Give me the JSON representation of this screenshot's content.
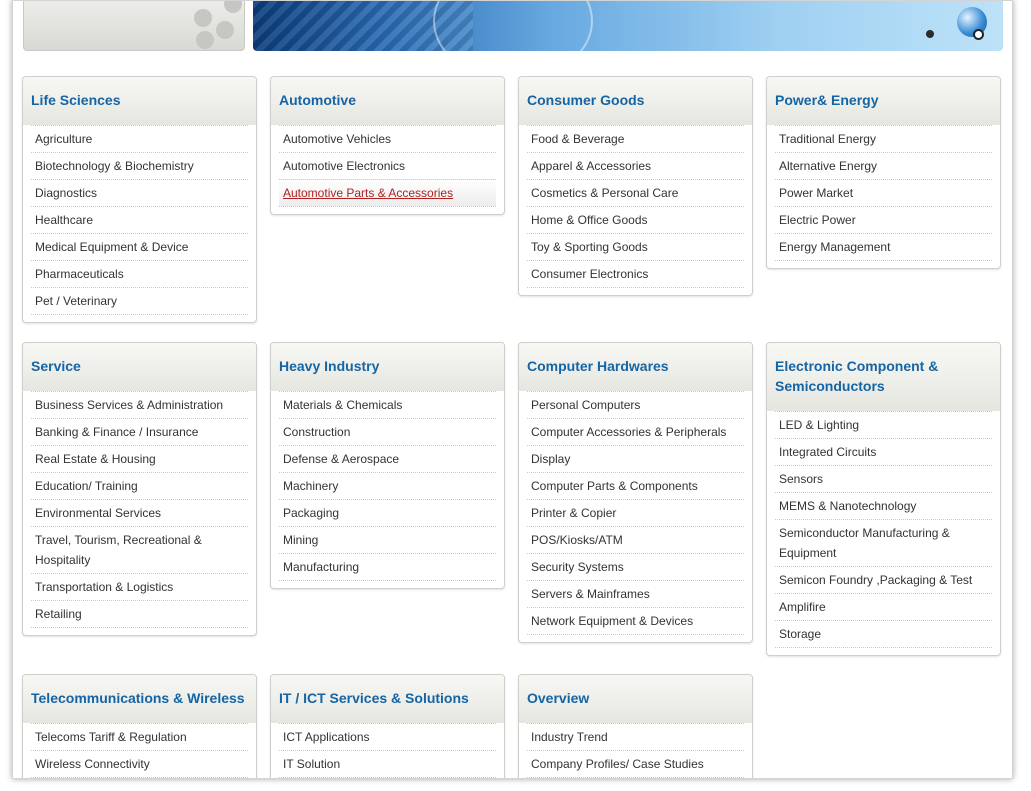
{
  "colors": {
    "title": "#1565a5",
    "link_active": "#b32020"
  },
  "banner": {
    "globe_icon": "globe-icon"
  },
  "categories": [
    {
      "title": "Life Sciences",
      "items": [
        "Agriculture",
        "Biotechnology & Biochemistry",
        "Diagnostics",
        "Healthcare",
        "Medical Equipment & Device",
        "Pharmaceuticals",
        "Pet / Veterinary"
      ]
    },
    {
      "title": "Automotive",
      "items": [
        "Automotive Vehicles",
        "Automotive Electronics",
        "Automotive Parts & Accessories"
      ]
    },
    {
      "title": "Consumer Goods",
      "items": [
        "Food & Beverage",
        "Apparel & Accessories",
        "Cosmetics & Personal Care",
        "Home & Office Goods",
        "Toy & Sporting Goods",
        "Consumer Electronics"
      ]
    },
    {
      "title": "Power& Energy",
      "items": [
        "Traditional Energy",
        "Alternative Energy",
        "Power Market",
        "Electric Power",
        "Energy Management"
      ]
    },
    {
      "title": "Service",
      "items": [
        "Business Services & Administration",
        "Banking & Finance / Insurance",
        "Real Estate & Housing",
        "Education/ Training",
        "Environmental Services",
        "Travel, Tourism, Recreational & Hospitality",
        "Transportation & Logistics",
        "Retailing"
      ]
    },
    {
      "title": "Heavy Industry",
      "items": [
        "Materials & Chemicals",
        "Construction",
        "Defense & Aerospace",
        "Machinery",
        "Packaging",
        "Mining",
        "Manufacturing"
      ]
    },
    {
      "title": "Computer Hardwares",
      "items": [
        "Personal Computers",
        "Computer Accessories & Peripherals",
        "Display",
        "Computer Parts & Components",
        "Printer & Copier",
        "POS/Kiosks/ATM",
        "Security Systems",
        "Servers & Mainframes",
        "Network Equipment & Devices"
      ]
    },
    {
      "title": "Electronic Component & Semiconductors",
      "items": [
        "LED & Lighting",
        "Integrated Circuits",
        "Sensors",
        "MEMS & Nanotechnology",
        "Semiconductor Manufacturing & Equipment",
        "Semicon Foundry ,Packaging & Test",
        "Amplifire",
        "Storage"
      ]
    },
    {
      "title": "Telecommunications & Wireless",
      "items": [
        "Telecoms Tariff & Regulation",
        "Wireless Connectivity"
      ]
    },
    {
      "title": "IT / ICT Services & Solutions",
      "items": [
        "ICT Applications",
        "IT Solution"
      ]
    },
    {
      "title": "Overview",
      "items": [
        "Industry Trend",
        "Company Profiles/ Case Studies"
      ]
    }
  ]
}
